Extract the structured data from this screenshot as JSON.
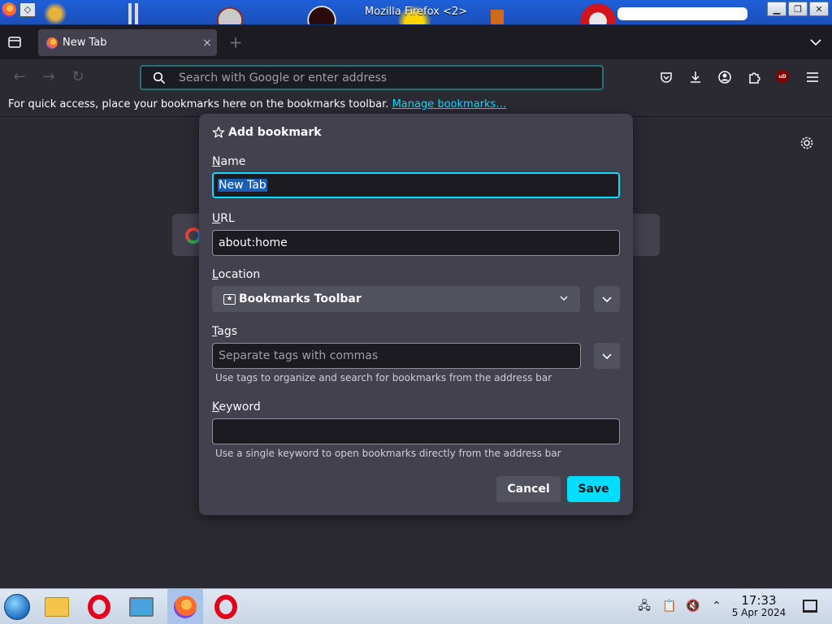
{
  "window": {
    "title": "Mozilla Firefox <2>",
    "buttons": [
      "minimize",
      "maximize",
      "close"
    ]
  },
  "tabstrip": {
    "tabs": [
      {
        "label": "New Tab",
        "close": "×"
      }
    ],
    "new_tab": "+"
  },
  "navbar": {
    "address_placeholder": "Search with Google or enter address"
  },
  "bookmarks_bar": {
    "message": "For quick access, place your bookmarks here on the bookmarks toolbar.",
    "link": "Manage bookmarks…"
  },
  "dialog": {
    "title": "Add bookmark",
    "name_label": {
      "accel": "N",
      "rest": "ame"
    },
    "name_value": "New Tab",
    "url_label": {
      "accel": "U",
      "rest": "RL"
    },
    "url_value": "about:home",
    "location_label": {
      "accel": "L",
      "rest": "ocation"
    },
    "location_value": "Bookmarks Toolbar",
    "tags_label": {
      "accel": "T",
      "rest": "ags"
    },
    "tags_placeholder": "Separate tags with commas",
    "tags_hint": "Use tags to organize and search for bookmarks from the address bar",
    "keyword_label": {
      "accel": "K",
      "rest": "eyword"
    },
    "keyword_value": "",
    "keyword_hint": "Use a single keyword to open bookmarks directly from the address bar",
    "cancel": "Cancel",
    "save": "Save"
  },
  "taskbar": {
    "time": "17:33",
    "date": "5 Apr 2024"
  },
  "colors": {
    "accent": "#00ddff",
    "dialog_bg": "#42414d",
    "page_bg": "#2b2a33"
  }
}
